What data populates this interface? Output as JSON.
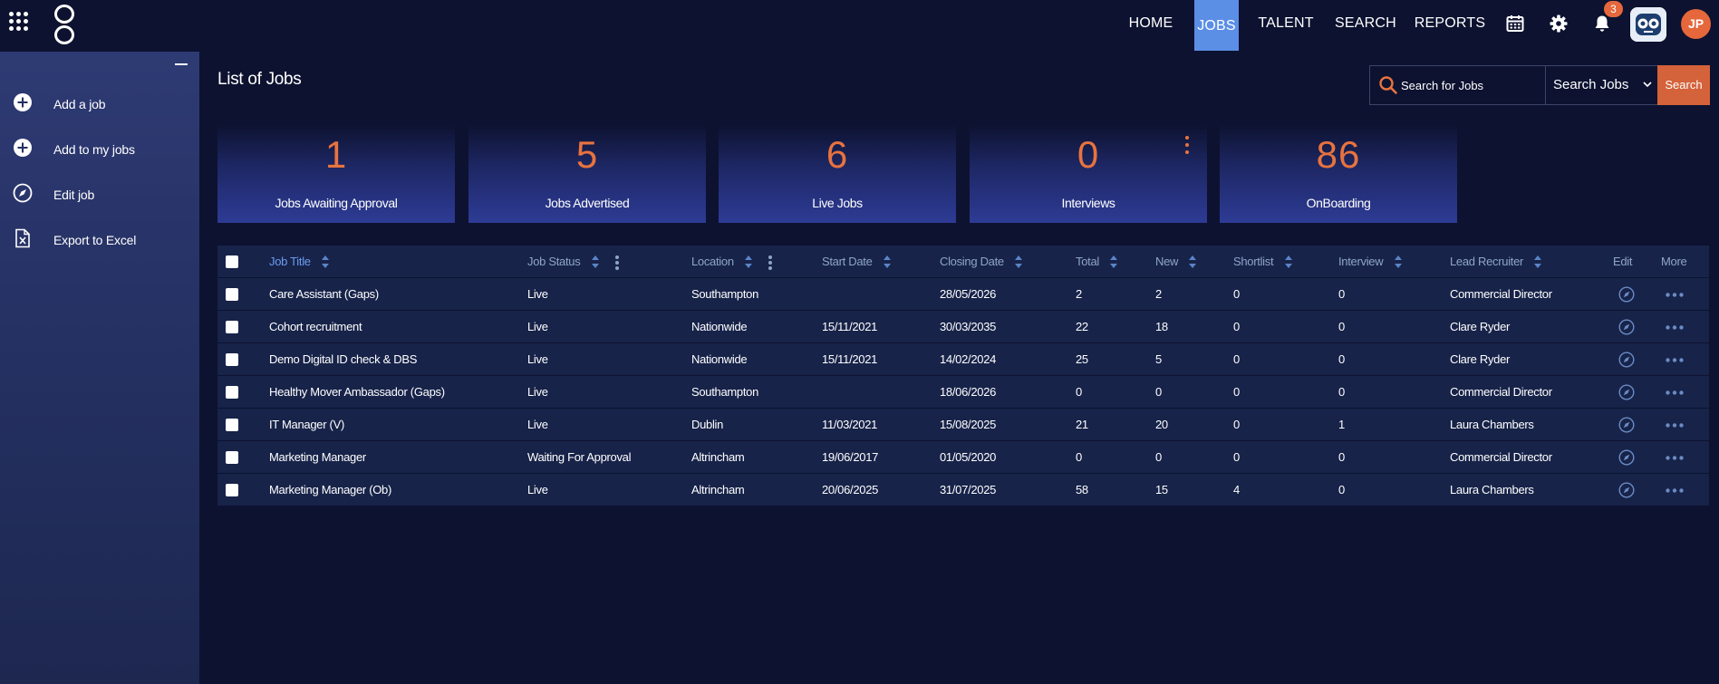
{
  "nav": {
    "items": [
      {
        "label": "HOME"
      },
      {
        "label": "JOBS"
      },
      {
        "label": "TALENT"
      },
      {
        "label": "SEARCH"
      },
      {
        "label": "REPORTS"
      }
    ],
    "notification_count": "3",
    "user_initials": "JP"
  },
  "sidebar": {
    "items": [
      {
        "label": "Add a job",
        "icon": "plus-circle-icon"
      },
      {
        "label": "Add to my jobs",
        "icon": "plus-circle-icon"
      },
      {
        "label": "Edit job",
        "icon": "compass-icon"
      },
      {
        "label": "Export to Excel",
        "icon": "excel-file-icon"
      }
    ]
  },
  "page": {
    "title": "List of Jobs"
  },
  "search": {
    "placeholder": "Search for Jobs",
    "scope": "Search Jobs",
    "button": "Search"
  },
  "stats": [
    {
      "value": "1",
      "label": "Jobs Awaiting Approval"
    },
    {
      "value": "5",
      "label": "Jobs Advertised"
    },
    {
      "value": "6",
      "label": "Live Jobs"
    },
    {
      "value": "0",
      "label": "Interviews"
    },
    {
      "value": "86",
      "label": "OnBoarding"
    }
  ],
  "table": {
    "headers": {
      "job_title": "Job Title",
      "job_status": "Job Status",
      "location": "Location",
      "start_date": "Start Date",
      "closing_date": "Closing Date",
      "total": "Total",
      "new": "New",
      "shortlist": "Shortlist",
      "interview": "Interview",
      "lead_recruiter": "Lead Recruiter",
      "edit": "Edit",
      "more": "More"
    },
    "rows": [
      {
        "job_title": "Care Assistant (Gaps)",
        "job_status": "Live",
        "location": "Southampton",
        "start_date": "",
        "closing_date": "28/05/2026",
        "total": "2",
        "new": "2",
        "shortlist": "0",
        "interview": "0",
        "lead_recruiter": "Commercial Director"
      },
      {
        "job_title": "Cohort recruitment",
        "job_status": "Live",
        "location": "Nationwide",
        "start_date": "15/11/2021",
        "closing_date": "30/03/2035",
        "total": "22",
        "new": "18",
        "shortlist": "0",
        "interview": "0",
        "lead_recruiter": "Clare Ryder"
      },
      {
        "job_title": "Demo Digital ID check & DBS",
        "job_status": "Live",
        "location": "Nationwide",
        "start_date": "15/11/2021",
        "closing_date": "14/02/2024",
        "total": "25",
        "new": "5",
        "shortlist": "0",
        "interview": "0",
        "lead_recruiter": "Clare Ryder"
      },
      {
        "job_title": "Healthy Mover Ambassador (Gaps)",
        "job_status": "Live",
        "location": "Southampton",
        "start_date": "",
        "closing_date": "18/06/2026",
        "total": "0",
        "new": "0",
        "shortlist": "0",
        "interview": "0",
        "lead_recruiter": "Commercial Director"
      },
      {
        "job_title": "IT Manager (V)",
        "job_status": "Live",
        "location": "Dublin",
        "start_date": "11/03/2021",
        "closing_date": "15/08/2025",
        "total": "21",
        "new": "20",
        "shortlist": "0",
        "interview": "1",
        "lead_recruiter": "Laura Chambers"
      },
      {
        "job_title": "Marketing Manager",
        "job_status": "Waiting For Approval",
        "location": "Altrincham",
        "start_date": "19/06/2017",
        "closing_date": "01/05/2020",
        "total": "0",
        "new": "0",
        "shortlist": "0",
        "interview": "0",
        "lead_recruiter": "Commercial Director"
      },
      {
        "job_title": "Marketing Manager (Ob)",
        "job_status": "Live",
        "location": "Altrincham",
        "start_date": "20/06/2025",
        "closing_date": "31/07/2025",
        "total": "58",
        "new": "15",
        "shortlist": "4",
        "interview": "0",
        "lead_recruiter": "Laura Chambers"
      }
    ]
  },
  "colors": {
    "background": "#0d1230",
    "accent_orange": "#e8733f",
    "nav_active": "#5b8fe6",
    "table_bg": "#172349"
  }
}
